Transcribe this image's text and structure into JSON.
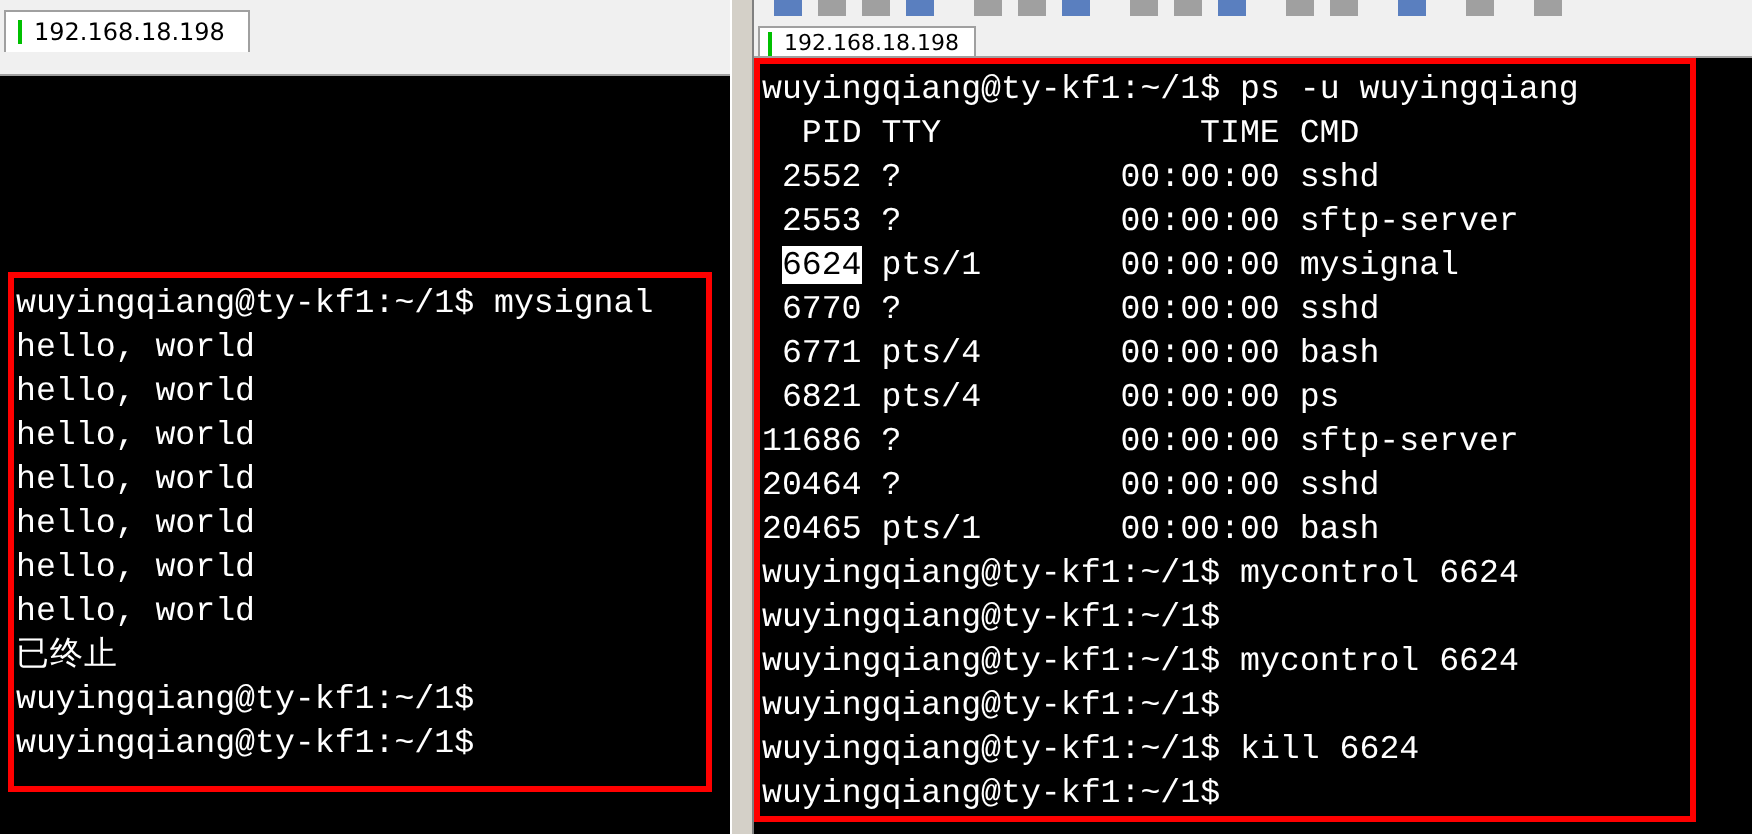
{
  "left_pane": {
    "tab": {
      "label": "192.168.18.198",
      "selected": true
    },
    "lines": [
      {
        "kind": "text",
        "text": "wuyingqiang@ty-kf1:~/1$ mysignal"
      },
      {
        "kind": "text",
        "text": "hello, world"
      },
      {
        "kind": "text",
        "text": "hello, world"
      },
      {
        "kind": "text",
        "text": "hello, world"
      },
      {
        "kind": "text",
        "text": "hello, world"
      },
      {
        "kind": "text",
        "text": "hello, world"
      },
      {
        "kind": "text",
        "text": "hello, world"
      },
      {
        "kind": "text",
        "text": "hello, world"
      },
      {
        "kind": "text",
        "text": "已终止"
      },
      {
        "kind": "text",
        "text": "wuyingqiang@ty-kf1:~/1$"
      },
      {
        "kind": "text",
        "text": "wuyingqiang@ty-kf1:~/1$"
      }
    ]
  },
  "right_pane": {
    "tab": {
      "label": "192.168.18.198",
      "selected": true
    },
    "lines": [
      {
        "kind": "text",
        "text": "wuyingqiang@ty-kf1:~/1$ ps -u wuyingqiang"
      },
      {
        "kind": "ps_header",
        "pid": "PID",
        "tty": "TTY",
        "time": "TIME",
        "cmd": "CMD"
      },
      {
        "kind": "ps_row",
        "pid": "2552",
        "tty": "?",
        "time": "00:00:00",
        "cmd": "sshd",
        "selected": false
      },
      {
        "kind": "ps_row",
        "pid": "2553",
        "tty": "?",
        "time": "00:00:00",
        "cmd": "sftp-server",
        "selected": false
      },
      {
        "kind": "ps_row",
        "pid": "6624",
        "tty": "pts/1",
        "time": "00:00:00",
        "cmd": "mysignal",
        "selected": true
      },
      {
        "kind": "ps_row",
        "pid": "6770",
        "tty": "?",
        "time": "00:00:00",
        "cmd": "sshd",
        "selected": false
      },
      {
        "kind": "ps_row",
        "pid": "6771",
        "tty": "pts/4",
        "time": "00:00:00",
        "cmd": "bash",
        "selected": false
      },
      {
        "kind": "ps_row",
        "pid": "6821",
        "tty": "pts/4",
        "time": "00:00:00",
        "cmd": "ps",
        "selected": false
      },
      {
        "kind": "ps_row",
        "pid": "11686",
        "tty": "?",
        "time": "00:00:00",
        "cmd": "sftp-server",
        "selected": false
      },
      {
        "kind": "ps_row",
        "pid": "20464",
        "tty": "?",
        "time": "00:00:00",
        "cmd": "sshd",
        "selected": false
      },
      {
        "kind": "ps_row",
        "pid": "20465",
        "tty": "pts/1",
        "time": "00:00:00",
        "cmd": "bash",
        "selected": false
      },
      {
        "kind": "text",
        "text": "wuyingqiang@ty-kf1:~/1$ mycontrol 6624"
      },
      {
        "kind": "text",
        "text": "wuyingqiang@ty-kf1:~/1$"
      },
      {
        "kind": "text",
        "text": "wuyingqiang@ty-kf1:~/1$ mycontrol 6624"
      },
      {
        "kind": "text",
        "text": "wuyingqiang@ty-kf1:~/1$"
      },
      {
        "kind": "text",
        "text": "wuyingqiang@ty-kf1:~/1$ kill 6624"
      },
      {
        "kind": "text",
        "text": "wuyingqiang@ty-kf1:~/1$"
      }
    ]
  }
}
